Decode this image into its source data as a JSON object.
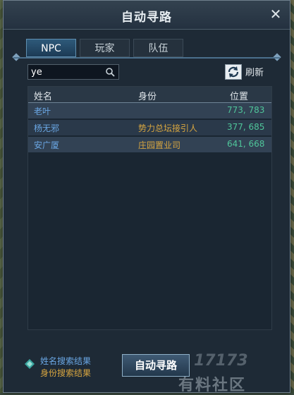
{
  "window": {
    "title": "自动寻路"
  },
  "tabs": [
    {
      "label": "NPC",
      "active": true
    },
    {
      "label": "玩家",
      "active": false
    },
    {
      "label": "队伍",
      "active": false
    }
  ],
  "search": {
    "value": "ye",
    "icon": "search-icon"
  },
  "refresh": {
    "label": "刷新",
    "icon": "refresh-icon"
  },
  "table": {
    "columns": [
      "姓名",
      "身份",
      "位置"
    ],
    "rows": [
      {
        "name": "老叶",
        "role": "",
        "pos": "773, 783"
      },
      {
        "name": "杨无邪",
        "role": "势力总坛接引人",
        "pos": "377, 685"
      },
      {
        "name": "安广厦",
        "role": "庄园置业司",
        "pos": "641, 668"
      }
    ]
  },
  "legend": {
    "name_result": "姓名搜索结果",
    "role_result": "身份搜索结果"
  },
  "auto_path_button": "自动寻路",
  "watermark": {
    "line1": "17173",
    "line2": "有料社区"
  },
  "colors": {
    "name": "#6aa7e4",
    "role": "#d8a640",
    "pos": "#4fc59a",
    "accent": "#5f8fb0"
  }
}
